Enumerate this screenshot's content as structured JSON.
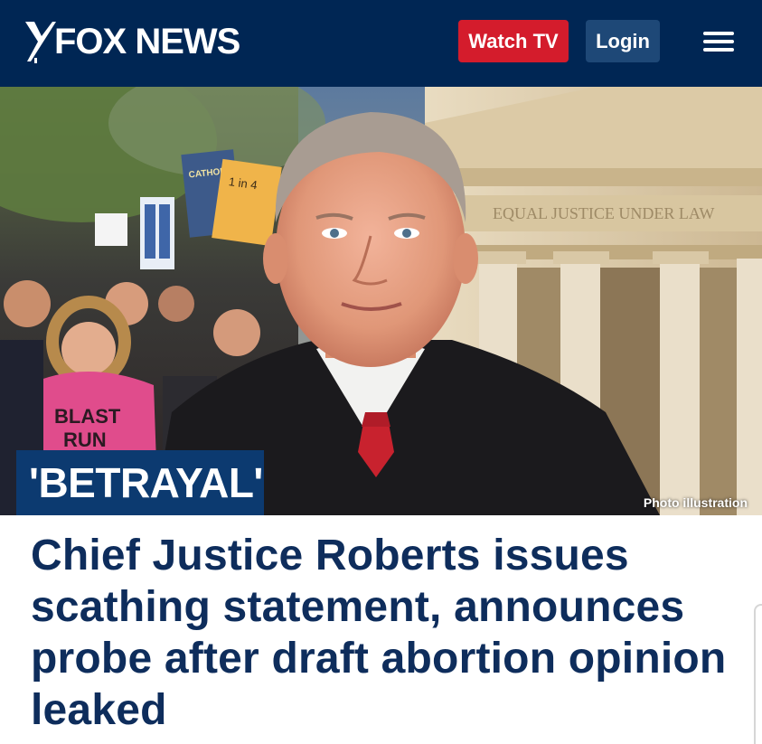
{
  "header": {
    "logo_text": "FOX NEWS",
    "watch_label": "Watch TV",
    "login_label": "Login",
    "menu_icon": "hamburger-menu-icon"
  },
  "hero": {
    "banner_text": "'BETRAYAL'",
    "credit_text": "Photo illustration",
    "sign_texts": [
      "CATHOLI SUPPO ABOR ACC",
      "1 in 4 GET AN ABO #SHOUT YOUR",
      "BLAST RUN"
    ],
    "building_inscription": "EQUAL JUSTICE UNDER LAW"
  },
  "article": {
    "headline": "Chief Justice Roberts issues scathing statement, announces probe after draft abortion opinion leaked"
  },
  "colors": {
    "header_bg": "#002654",
    "watch_button": "#d41c2c",
    "login_button": "#1e4877",
    "banner_bg": "#0c3a70",
    "headline_text": "#0e2d5c"
  }
}
